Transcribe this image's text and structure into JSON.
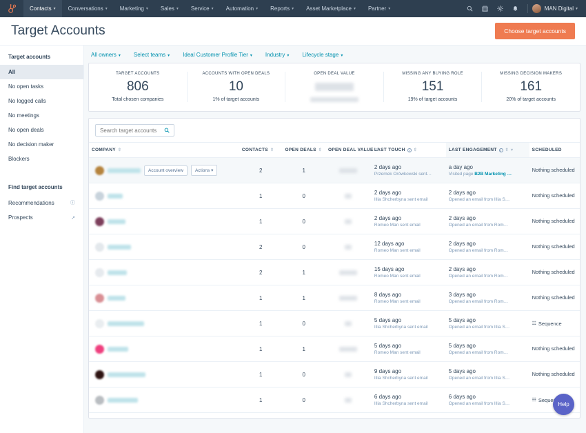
{
  "topnav": {
    "logo_icon": "hubspot-sprocket-icon",
    "items": [
      {
        "label": "Contacts",
        "active": true,
        "caret": true
      },
      {
        "label": "Conversations",
        "active": false,
        "caret": true
      },
      {
        "label": "Marketing",
        "active": false,
        "caret": true
      },
      {
        "label": "Sales",
        "active": false,
        "caret": true
      },
      {
        "label": "Service",
        "active": false,
        "caret": true
      },
      {
        "label": "Automation",
        "active": false,
        "caret": true
      },
      {
        "label": "Reports",
        "active": false,
        "caret": true
      },
      {
        "label": "Asset Marketplace",
        "active": false,
        "caret": true
      },
      {
        "label": "Partner",
        "active": false,
        "caret": true
      }
    ],
    "icons": [
      "search-icon",
      "marketplace-icon",
      "settings-gear-icon",
      "notifications-bell-icon"
    ],
    "account_name": "MAN Digital",
    "caret_glyph": "▾"
  },
  "header": {
    "title": "Target Accounts",
    "primary_button": "Choose target accounts",
    "accent_color": "#ef7b51"
  },
  "sidebar": {
    "section1_title": "Target accounts",
    "views": [
      {
        "label": "All",
        "active": true
      },
      {
        "label": "No open tasks",
        "active": false
      },
      {
        "label": "No logged calls",
        "active": false
      },
      {
        "label": "No meetings",
        "active": false
      },
      {
        "label": "No open deals",
        "active": false
      },
      {
        "label": "No decision maker",
        "active": false
      },
      {
        "label": "Blockers",
        "active": false
      }
    ],
    "section2_title": "Find target accounts",
    "tools": [
      {
        "label": "Recommendations",
        "icon": "info-icon"
      },
      {
        "label": "Prospects",
        "icon": "external-link-icon"
      }
    ]
  },
  "filters": [
    {
      "label": "All owners"
    },
    {
      "label": "Select teams"
    },
    {
      "label": "Ideal Customer Profile Tier"
    },
    {
      "label": "Industry"
    },
    {
      "label": "Lifecycle stage"
    }
  ],
  "stats": [
    {
      "label": "TARGET ACCOUNTS",
      "value": "806",
      "sub": "Total chosen companies",
      "redacted_value": false,
      "redacted_sub": false
    },
    {
      "label": "ACCOUNTS WITH OPEN DEALS",
      "value": "10",
      "sub": "1% of target accounts",
      "redacted_value": false,
      "redacted_sub": false
    },
    {
      "label": "OPEN DEAL VALUE",
      "value": "",
      "sub": "",
      "redacted_value": true,
      "redacted_sub": true
    },
    {
      "label": "MISSING ANY BUYING ROLE",
      "value": "151",
      "sub": "19% of target accounts",
      "redacted_value": false,
      "redacted_sub": false
    },
    {
      "label": "MISSING DECISION MAKERS",
      "value": "161",
      "sub": "20% of target accounts",
      "redacted_value": false,
      "redacted_sub": false
    }
  ],
  "search": {
    "placeholder": "Search target accounts",
    "value": "",
    "icon": "search-icon"
  },
  "table": {
    "columns": [
      {
        "label": "COMPANY",
        "sortable": true,
        "info": false,
        "sorted": false
      },
      {
        "label": "CONTACTS",
        "sortable": true,
        "info": false,
        "sorted": false
      },
      {
        "label": "OPEN DEALS",
        "sortable": true,
        "info": false,
        "sorted": false
      },
      {
        "label": "OPEN DEAL VALUE",
        "sortable": true,
        "info": false,
        "sorted": false
      },
      {
        "label": "LAST TOUCH",
        "sortable": true,
        "info": true,
        "sorted": false
      },
      {
        "label": "LAST ENGAGEMENT",
        "sortable": true,
        "info": true,
        "sorted": true
      },
      {
        "label": "SCHEDULED",
        "sortable": false,
        "info": false,
        "sorted": false
      }
    ],
    "row_buttons": {
      "overview": "Account overview",
      "actions": "Actions"
    },
    "rows": [
      {
        "avatar_color": "#b5833d",
        "name_width": 48,
        "first": true,
        "contacts": "2",
        "open_deals": "1",
        "deal_value_redacted": true,
        "deal_value_width": 26,
        "last_touch_time": "2 days ago",
        "last_touch_detail": "Przemek Orówkowski sent…",
        "last_touch_link": "",
        "last_engagement_time": "a day ago",
        "last_engagement_detail": "Visited page ",
        "last_engagement_link": "B2B Marketing …",
        "scheduled": "Nothing scheduled",
        "scheduled_is_sequence": false
      },
      {
        "avatar_color": "#c8d3dc",
        "name_width": 22,
        "first": false,
        "contacts": "1",
        "open_deals": "0",
        "deal_value_redacted": true,
        "deal_value_width": 10,
        "last_touch_time": "2 days ago",
        "last_touch_detail": "Illia Shcherbyna sent email",
        "last_touch_link": "",
        "last_engagement_time": "2 days ago",
        "last_engagement_detail": "Opened an email from Illia S…",
        "last_engagement_link": "",
        "scheduled": "Nothing scheduled",
        "scheduled_is_sequence": false
      },
      {
        "avatar_color": "#7d3f5c",
        "name_width": 26,
        "first": false,
        "contacts": "1",
        "open_deals": "0",
        "deal_value_redacted": true,
        "deal_value_width": 10,
        "last_touch_time": "2 days ago",
        "last_touch_detail": "Romeo Man sent email",
        "last_touch_link": "",
        "last_engagement_time": "2 days ago",
        "last_engagement_detail": "Opened an email from Rom…",
        "last_engagement_link": "",
        "scheduled": "Nothing scheduled",
        "scheduled_is_sequence": false
      },
      {
        "avatar_color": "#e3e8ec",
        "name_width": 34,
        "first": false,
        "contacts": "2",
        "open_deals": "0",
        "deal_value_redacted": true,
        "deal_value_width": 10,
        "last_touch_time": "12 days ago",
        "last_touch_detail": "Romeo Man sent email",
        "last_touch_link": "",
        "last_engagement_time": "2 days ago",
        "last_engagement_detail": "Opened an email from Rom…",
        "last_engagement_link": "",
        "scheduled": "Nothing scheduled",
        "scheduled_is_sequence": false
      },
      {
        "avatar_color": "#e6eaee",
        "name_width": 28,
        "first": false,
        "contacts": "2",
        "open_deals": "1",
        "deal_value_redacted": true,
        "deal_value_width": 26,
        "last_touch_time": "15 days ago",
        "last_touch_detail": "Romeo Man sent email",
        "last_touch_link": "",
        "last_engagement_time": "2 days ago",
        "last_engagement_detail": "Opened an email from Rom…",
        "last_engagement_link": "",
        "scheduled": "Nothing scheduled",
        "scheduled_is_sequence": false
      },
      {
        "avatar_color": "#d98f94",
        "name_width": 26,
        "first": false,
        "contacts": "1",
        "open_deals": "1",
        "deal_value_redacted": true,
        "deal_value_width": 26,
        "last_touch_time": "8 days ago",
        "last_touch_detail": "Romeo Man sent email",
        "last_touch_link": "",
        "last_engagement_time": "3 days ago",
        "last_engagement_detail": "Opened an email from Rom…",
        "last_engagement_link": "",
        "scheduled": "Nothing scheduled",
        "scheduled_is_sequence": false
      },
      {
        "avatar_color": "#e9edf0",
        "name_width": 53,
        "first": false,
        "contacts": "1",
        "open_deals": "0",
        "deal_value_redacted": true,
        "deal_value_width": 10,
        "last_touch_time": "5 days ago",
        "last_touch_detail": "Illia Shcherbyna sent email",
        "last_touch_link": "",
        "last_engagement_time": "5 days ago",
        "last_engagement_detail": "Opened an email from Illia S…",
        "last_engagement_link": "",
        "scheduled": "Sequence",
        "scheduled_is_sequence": true
      },
      {
        "avatar_color": "#ef3f7e",
        "name_width": 30,
        "first": false,
        "contacts": "1",
        "open_deals": "1",
        "deal_value_redacted": true,
        "deal_value_width": 26,
        "last_touch_time": "5 days ago",
        "last_touch_detail": "Romeo Man sent email",
        "last_touch_link": "",
        "last_engagement_time": "5 days ago",
        "last_engagement_detail": "Opened an email from Rom…",
        "last_engagement_link": "",
        "scheduled": "Nothing scheduled",
        "scheduled_is_sequence": false
      },
      {
        "avatar_color": "#2e1412",
        "name_width": 55,
        "first": false,
        "contacts": "1",
        "open_deals": "0",
        "deal_value_redacted": true,
        "deal_value_width": 10,
        "last_touch_time": "9 days ago",
        "last_touch_detail": "Illia Shcherbyna sent email",
        "last_touch_link": "",
        "last_engagement_time": "5 days ago",
        "last_engagement_detail": "Opened an email from Illia S…",
        "last_engagement_link": "",
        "scheduled": "Nothing scheduled",
        "scheduled_is_sequence": false
      },
      {
        "avatar_color": "#b9bdc1",
        "name_width": 44,
        "first": false,
        "contacts": "1",
        "open_deals": "0",
        "deal_value_redacted": true,
        "deal_value_width": 10,
        "last_touch_time": "6 days ago",
        "last_touch_detail": "Illia Shcherbyna sent email",
        "last_touch_link": "",
        "last_engagement_time": "6 days ago",
        "last_engagement_detail": "Opened an email from Illia S…",
        "last_engagement_link": "",
        "scheduled": "Sequence",
        "scheduled_is_sequence": true
      }
    ]
  },
  "help_button": {
    "label": "Help",
    "color": "#5a63c7"
  }
}
